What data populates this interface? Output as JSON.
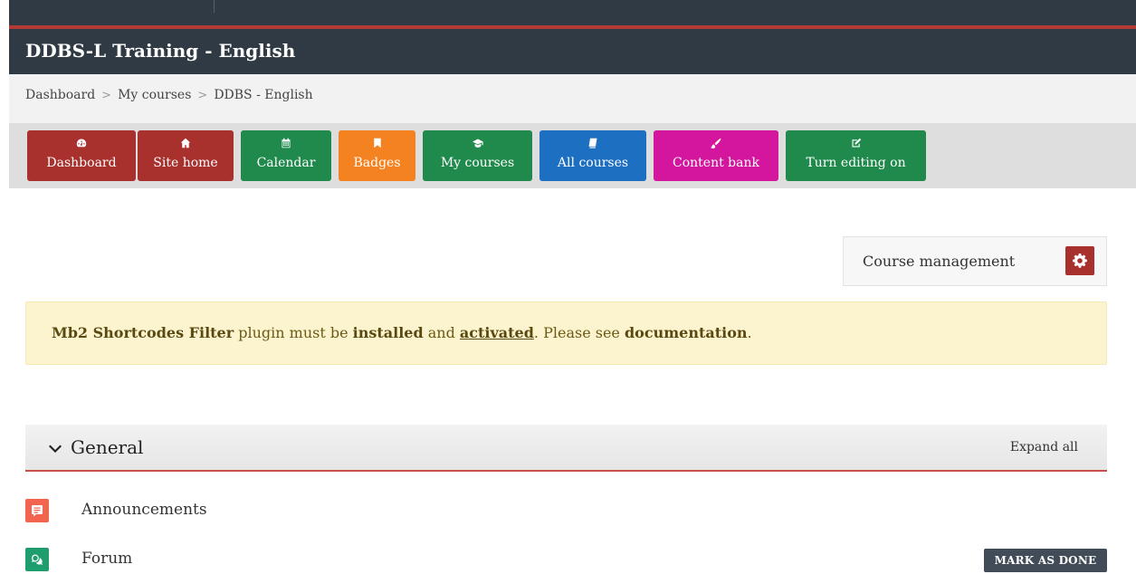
{
  "site": {
    "title": "DDBS-L Training - English"
  },
  "breadcrumb": [
    "Dashboard",
    "My courses",
    "DDBS - English"
  ],
  "nav": [
    {
      "label": "Dashboard",
      "icon": "dashboard-icon",
      "color": "#a8302d"
    },
    {
      "label": "Site home",
      "icon": "home-icon",
      "color": "#a8302d"
    },
    {
      "label": "Calendar",
      "icon": "calendar-icon",
      "color": "#1f8a4c"
    },
    {
      "label": "Badges",
      "icon": "bookmark-icon",
      "color": "#f58220"
    },
    {
      "label": "My courses",
      "icon": "graduation-cap-icon",
      "color": "#1f8a4c"
    },
    {
      "label": "All courses",
      "icon": "book-icon",
      "color": "#1d6fc2"
    },
    {
      "label": "Content bank",
      "icon": "paintbrush-icon",
      "color": "#d3169d"
    },
    {
      "label": "Turn editing on",
      "icon": "edit-icon",
      "color": "#1f8a4c"
    }
  ],
  "course_management": {
    "label": "Course management",
    "icon": "gear-icon"
  },
  "alert": {
    "part1": "Mb2 Shortcodes Filter",
    "part2": " plugin must be ",
    "part3": "installed",
    "part4": " and ",
    "part5": "activated",
    "part6": ". Please see ",
    "part7": "documentation",
    "part8": "."
  },
  "section": {
    "title": "General",
    "expand_label": "Expand all"
  },
  "activities": [
    {
      "name": "Announcements",
      "icon": "announcement-icon",
      "color": "#f3644f"
    },
    {
      "name": "Forum",
      "icon": "forum-icon",
      "color": "#1e9e6e",
      "action": "MARK AS DONE"
    }
  ]
}
